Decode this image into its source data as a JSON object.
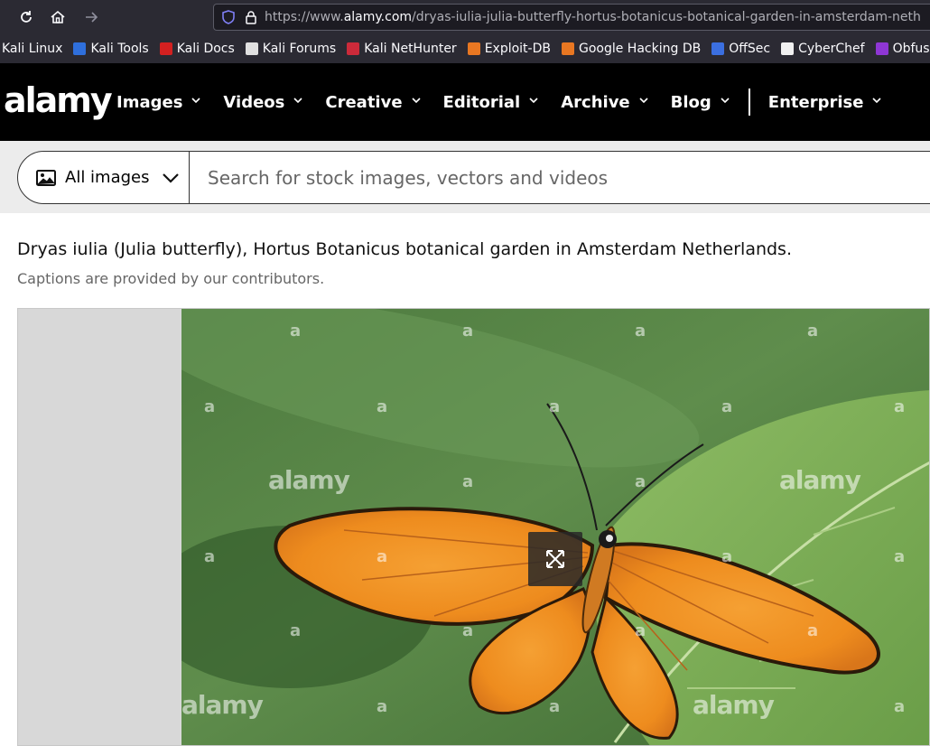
{
  "browser": {
    "url_prefix": "https://www.",
    "url_domain": "alamy.com",
    "url_path": "/dryas-iulia-julia-butterfly-hortus-botanicus-botanical-garden-in-amsterdam-neth",
    "bookmarks": [
      {
        "label": "Kali Linux",
        "color": "#367bf0"
      },
      {
        "label": "Kali Tools",
        "color": "#2f6fdc"
      },
      {
        "label": "Kali Docs",
        "color": "#d32020"
      },
      {
        "label": "Kali Forums",
        "color": "#e0e0e0"
      },
      {
        "label": "Kali NetHunter",
        "color": "#cc2a3a"
      },
      {
        "label": "Exploit-DB",
        "color": "#e87722"
      },
      {
        "label": "Google Hacking DB",
        "color": "#e87722"
      },
      {
        "label": "OffSec",
        "color": "#3b6fe0"
      },
      {
        "label": "CyberChef",
        "color": "#f0f0f0"
      },
      {
        "label": "Obfuscator",
        "color": "#8e36d4"
      }
    ]
  },
  "header": {
    "logo": "alamy",
    "menu": [
      "Images",
      "Videos",
      "Creative",
      "Editorial",
      "Archive",
      "Blog"
    ],
    "enterprise": "Enterprise"
  },
  "search": {
    "category": "All images",
    "placeholder": "Search for stock images, vectors and videos"
  },
  "caption": {
    "title": "Dryas iulia (Julia butterfly), Hortus Botanicus botanical garden in Amsterdam Netherlands.",
    "subtitle": "Captions are provided by our contributors."
  },
  "image": {
    "watermark": "alamy",
    "watermark_small": "a"
  }
}
